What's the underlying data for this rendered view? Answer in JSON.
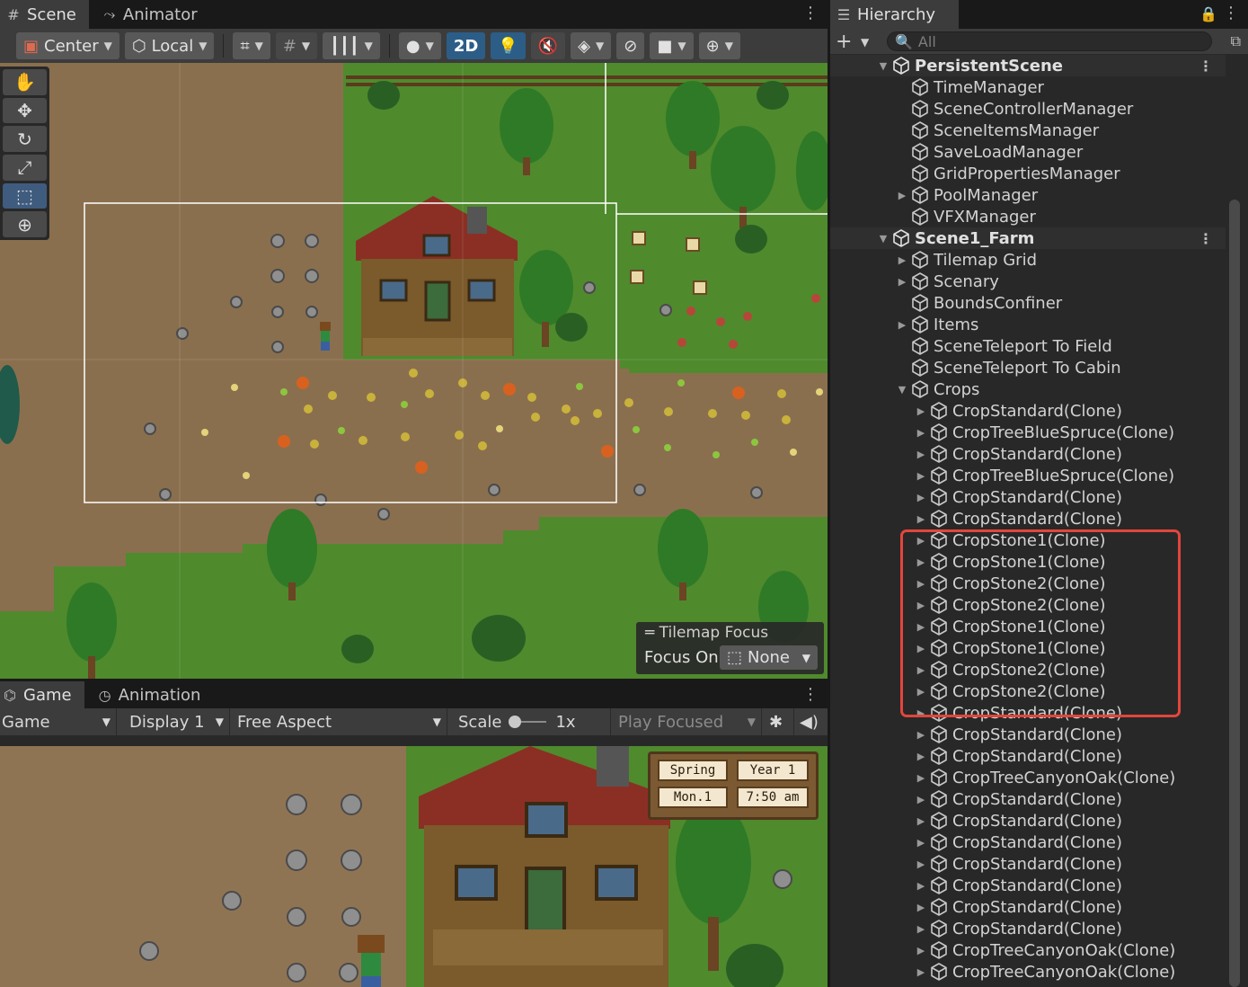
{
  "scene_panel": {
    "tabs": [
      {
        "label": "Scene",
        "icon": "grid-icon"
      },
      {
        "label": "Animator",
        "icon": "animator-icon"
      }
    ],
    "toolbar": {
      "pivot_mode": "Center",
      "pivot_rotation": "Local",
      "mode_2d": "2D"
    },
    "tilemap_focus": {
      "title": "Tilemap Focus",
      "label": "Focus On",
      "value": "None"
    }
  },
  "game_panel": {
    "tabs": [
      {
        "label": "Game",
        "icon": "gamepad-icon"
      },
      {
        "label": "Animation",
        "icon": "clock-icon"
      }
    ],
    "toolbar": {
      "view": "Game",
      "display": "Display 1",
      "aspect": "Free Aspect",
      "scale_label": "Scale",
      "scale_value": "1x",
      "play_mode": "Play Focused"
    },
    "hud": {
      "season": "Spring",
      "year": "Year 1",
      "day": "Mon.1",
      "time": "7:50 am"
    }
  },
  "hierarchy": {
    "tab_label": "Hierarchy",
    "search_placeholder": "All",
    "items": [
      {
        "label": "PersistentScene",
        "kind": "scene",
        "depth": 0,
        "expand": "open"
      },
      {
        "label": "TimeManager",
        "kind": "object",
        "depth": 1,
        "expand": "none"
      },
      {
        "label": "SceneControllerManager",
        "kind": "object",
        "depth": 1,
        "expand": "none"
      },
      {
        "label": "SceneItemsManager",
        "kind": "object",
        "depth": 1,
        "expand": "none"
      },
      {
        "label": "SaveLoadManager",
        "kind": "object",
        "depth": 1,
        "expand": "none"
      },
      {
        "label": "GridPropertiesManager",
        "kind": "object",
        "depth": 1,
        "expand": "none"
      },
      {
        "label": "PoolManager",
        "kind": "object",
        "depth": 1,
        "expand": "closed"
      },
      {
        "label": "VFXManager",
        "kind": "object",
        "depth": 1,
        "expand": "none"
      },
      {
        "label": "Scene1_Farm",
        "kind": "scene",
        "depth": 0,
        "expand": "open"
      },
      {
        "label": "Tilemap Grid",
        "kind": "object",
        "depth": 1,
        "expand": "closed"
      },
      {
        "label": "Scenary",
        "kind": "object",
        "depth": 1,
        "expand": "closed"
      },
      {
        "label": "BoundsConfiner",
        "kind": "object",
        "depth": 1,
        "expand": "none"
      },
      {
        "label": "Items",
        "kind": "object",
        "depth": 1,
        "expand": "closed"
      },
      {
        "label": "SceneTeleport To Field",
        "kind": "object",
        "depth": 1,
        "expand": "none"
      },
      {
        "label": "SceneTeleport  To Cabin",
        "kind": "object",
        "depth": 1,
        "expand": "none"
      },
      {
        "label": "Crops",
        "kind": "object",
        "depth": 1,
        "expand": "open"
      },
      {
        "label": "CropStandard(Clone)",
        "kind": "object",
        "depth": 2,
        "expand": "closed"
      },
      {
        "label": "CropTreeBlueSpruce(Clone)",
        "kind": "object",
        "depth": 2,
        "expand": "closed"
      },
      {
        "label": "CropStandard(Clone)",
        "kind": "object",
        "depth": 2,
        "expand": "closed"
      },
      {
        "label": "CropTreeBlueSpruce(Clone)",
        "kind": "object",
        "depth": 2,
        "expand": "closed"
      },
      {
        "label": "CropStandard(Clone)",
        "kind": "object",
        "depth": 2,
        "expand": "closed"
      },
      {
        "label": "CropStandard(Clone)",
        "kind": "object",
        "depth": 2,
        "expand": "closed"
      },
      {
        "label": "CropStone1(Clone)",
        "kind": "object",
        "depth": 2,
        "expand": "closed"
      },
      {
        "label": "CropStone1(Clone)",
        "kind": "object",
        "depth": 2,
        "expand": "closed"
      },
      {
        "label": "CropStone2(Clone)",
        "kind": "object",
        "depth": 2,
        "expand": "closed"
      },
      {
        "label": "CropStone2(Clone)",
        "kind": "object",
        "depth": 2,
        "expand": "closed"
      },
      {
        "label": "CropStone1(Clone)",
        "kind": "object",
        "depth": 2,
        "expand": "closed"
      },
      {
        "label": "CropStone1(Clone)",
        "kind": "object",
        "depth": 2,
        "expand": "closed"
      },
      {
        "label": "CropStone2(Clone)",
        "kind": "object",
        "depth": 2,
        "expand": "closed"
      },
      {
        "label": "CropStone2(Clone)",
        "kind": "object",
        "depth": 2,
        "expand": "closed"
      },
      {
        "label": "CropStandard(Clone)",
        "kind": "object",
        "depth": 2,
        "expand": "closed"
      },
      {
        "label": "CropStandard(Clone)",
        "kind": "object",
        "depth": 2,
        "expand": "closed"
      },
      {
        "label": "CropStandard(Clone)",
        "kind": "object",
        "depth": 2,
        "expand": "closed"
      },
      {
        "label": "CropTreeCanyonOak(Clone)",
        "kind": "object",
        "depth": 2,
        "expand": "closed"
      },
      {
        "label": "CropStandard(Clone)",
        "kind": "object",
        "depth": 2,
        "expand": "closed"
      },
      {
        "label": "CropStandard(Clone)",
        "kind": "object",
        "depth": 2,
        "expand": "closed"
      },
      {
        "label": "CropStandard(Clone)",
        "kind": "object",
        "depth": 2,
        "expand": "closed"
      },
      {
        "label": "CropStandard(Clone)",
        "kind": "object",
        "depth": 2,
        "expand": "closed"
      },
      {
        "label": "CropStandard(Clone)",
        "kind": "object",
        "depth": 2,
        "expand": "closed"
      },
      {
        "label": "CropStandard(Clone)",
        "kind": "object",
        "depth": 2,
        "expand": "closed"
      },
      {
        "label": "CropStandard(Clone)",
        "kind": "object",
        "depth": 2,
        "expand": "closed"
      },
      {
        "label": "CropTreeCanyonOak(Clone)",
        "kind": "object",
        "depth": 2,
        "expand": "closed"
      },
      {
        "label": "CropTreeCanyonOak(Clone)",
        "kind": "object",
        "depth": 2,
        "expand": "closed"
      }
    ]
  },
  "colors": {
    "panel_bg": "#282828",
    "toolbar_bg": "#3c3c3c",
    "highlight": "#e2463c",
    "accent_blue": "#2c5d87",
    "grass": "#4f8a2d",
    "dirt": "#8a6f4e"
  }
}
